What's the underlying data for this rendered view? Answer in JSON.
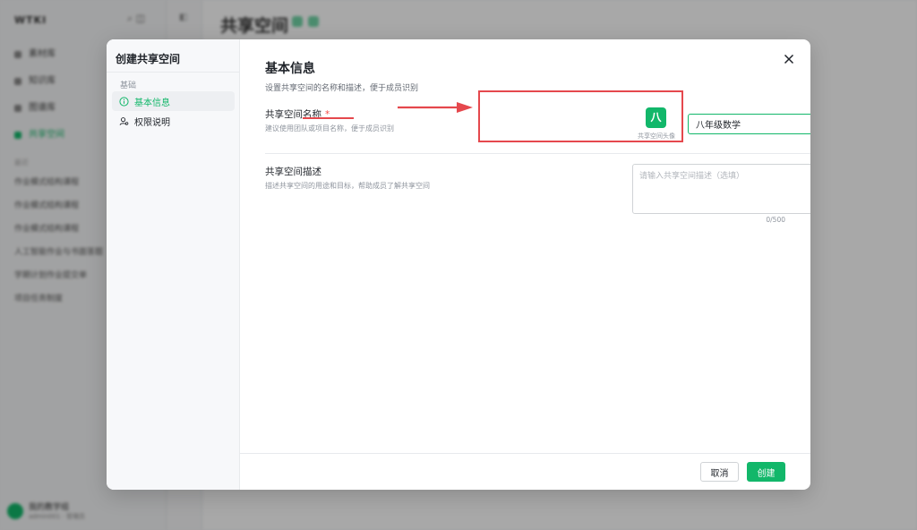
{
  "background": {
    "logo": "WTKI",
    "nav": [
      "素材库",
      "知识库",
      "图谱库",
      "共享空间"
    ],
    "section": "最近",
    "recent": [
      "作业模式结构课程",
      "作业模式结构课程",
      "作业模式结构课程",
      "人工智能作业与书面答题",
      "学期计划作业提交单",
      "项目任务制度"
    ],
    "user_name": "我的教学组",
    "user_sub": "admin001 · 管理员",
    "page_title": "共享空间"
  },
  "modal": {
    "title": "创建共享空间",
    "group_label": "基础",
    "nav": [
      {
        "label": "基本信息",
        "icon": "info-circle-icon",
        "active": true
      },
      {
        "label": "权限说明",
        "icon": "user-permission-icon",
        "active": false
      }
    ],
    "section_title": "基本信息",
    "section_subtitle": "设置共享空间的名称和描述，便于成员识别",
    "name_field": {
      "label": "共享空间名称",
      "required_mark": "*",
      "hint": "建议使用团队或项目名称，便于成员识别",
      "value": "八年级数学",
      "avatar_char": "八",
      "avatar_caption": "共享空间头像"
    },
    "desc_field": {
      "label": "共享空间描述",
      "hint": "描述共享空间的用途和目标，帮助成员了解共享空间",
      "placeholder": "请输入共享空间描述（选填）",
      "counter": "0/500"
    },
    "cancel_label": "取消",
    "create_label": "创建"
  },
  "colors": {
    "accent": "#12b76a",
    "annotation": "#e5484d"
  }
}
